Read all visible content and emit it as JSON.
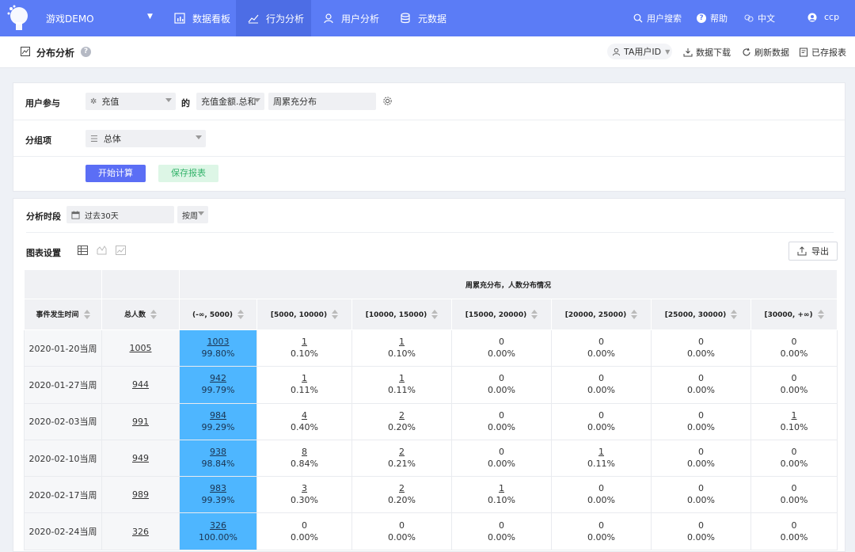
{
  "nav": {
    "app_name": "游戏DEMO",
    "tabs": [
      {
        "label": "数据看板",
        "icon": "dashboard-icon"
      },
      {
        "label": "行为分析",
        "icon": "trend-icon"
      },
      {
        "label": "用户分析",
        "icon": "user-icon"
      },
      {
        "label": "元数据",
        "icon": "database-icon"
      }
    ],
    "search_user": "用户搜索",
    "help": "帮助",
    "language": "中文",
    "username": "ccp"
  },
  "header": {
    "title": "分布分析",
    "ta_select": "TA用户ID",
    "download": "数据下载",
    "refresh": "刷新数据",
    "saved_reports": "已存报表"
  },
  "query": {
    "participate_label": "用户参与",
    "event": "充值",
    "of": "的",
    "metric": "充值金额.总和",
    "name": "周累充分布",
    "group_label": "分组项",
    "group_value": "总体",
    "start_button": "开始计算",
    "save_button": "保存报表"
  },
  "results": {
    "period_label": "分析时段",
    "date_range": "过去30天",
    "granularity": "按周",
    "chart_settings_label": "图表设置",
    "export_label": "导出",
    "table": {
      "group_header": "周累充分布，人数分布情况",
      "col_time": "事件发生时间",
      "col_total": "总人数",
      "buckets": [
        "(-∞, 5000)",
        "[5000, 10000)",
        "[10000, 15000)",
        "[15000, 20000)",
        "[20000, 25000)",
        "[25000, 30000)",
        "[30000, +∞)"
      ],
      "rows": [
        {
          "date": "2020-01-20当周",
          "total": "1005",
          "cells": [
            [
              "1003",
              "99.80%"
            ],
            [
              "1",
              "0.10%"
            ],
            [
              "1",
              "0.10%"
            ],
            [
              "0",
              "0.00%"
            ],
            [
              "0",
              "0.00%"
            ],
            [
              "0",
              "0.00%"
            ],
            [
              "0",
              "0.00%"
            ]
          ]
        },
        {
          "date": "2020-01-27当周",
          "total": "944",
          "cells": [
            [
              "942",
              "99.79%"
            ],
            [
              "1",
              "0.11%"
            ],
            [
              "1",
              "0.11%"
            ],
            [
              "0",
              "0.00%"
            ],
            [
              "0",
              "0.00%"
            ],
            [
              "0",
              "0.00%"
            ],
            [
              "0",
              "0.00%"
            ]
          ]
        },
        {
          "date": "2020-02-03当周",
          "total": "991",
          "cells": [
            [
              "984",
              "99.29%"
            ],
            [
              "4",
              "0.40%"
            ],
            [
              "2",
              "0.20%"
            ],
            [
              "0",
              "0.00%"
            ],
            [
              "0",
              "0.00%"
            ],
            [
              "0",
              "0.00%"
            ],
            [
              "1",
              "0.10%"
            ]
          ]
        },
        {
          "date": "2020-02-10当周",
          "total": "949",
          "cells": [
            [
              "938",
              "98.84%"
            ],
            [
              "8",
              "0.84%"
            ],
            [
              "2",
              "0.21%"
            ],
            [
              "0",
              "0.00%"
            ],
            [
              "1",
              "0.11%"
            ],
            [
              "0",
              "0.00%"
            ],
            [
              "0",
              "0.00%"
            ]
          ]
        },
        {
          "date": "2020-02-17当周",
          "total": "989",
          "cells": [
            [
              "983",
              "99.39%"
            ],
            [
              "3",
              "0.30%"
            ],
            [
              "2",
              "0.20%"
            ],
            [
              "1",
              "0.10%"
            ],
            [
              "0",
              "0.00%"
            ],
            [
              "0",
              "0.00%"
            ],
            [
              "0",
              "0.00%"
            ]
          ]
        },
        {
          "date": "2020-02-24当周",
          "total": "326",
          "cells": [
            [
              "326",
              "100.00%"
            ],
            [
              "0",
              "0.00%"
            ],
            [
              "0",
              "0.00%"
            ],
            [
              "0",
              "0.00%"
            ],
            [
              "0",
              "0.00%"
            ],
            [
              "0",
              "0.00%"
            ],
            [
              "0",
              "0.00%"
            ]
          ]
        }
      ]
    }
  },
  "colors": {
    "nav_bg": "#5b7cf6",
    "highlight_cell": "#4eb6ff",
    "primary_button": "#5b6ef5",
    "save_button_text": "#35b36b"
  }
}
